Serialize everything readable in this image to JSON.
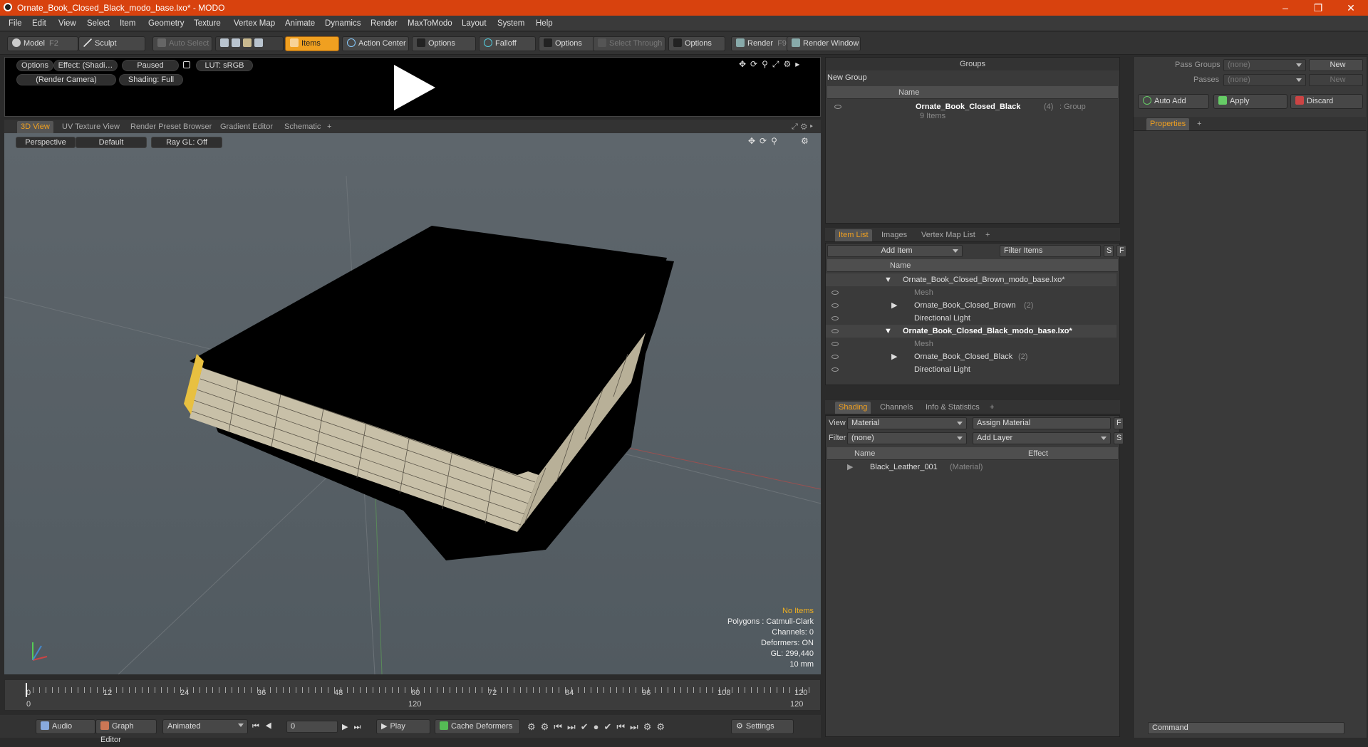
{
  "window": {
    "title": "Ornate_Book_Closed_Black_modo_base.lxo* - MODO"
  },
  "menu": [
    "File",
    "Edit",
    "View",
    "Select",
    "Item",
    "Geometry",
    "Texture",
    "Vertex Map",
    "Animate",
    "Dynamics",
    "Render",
    "MaxToModo",
    "Layout",
    "System",
    "Help"
  ],
  "toolbar": {
    "model": "Model",
    "model_key": "F2",
    "sculpt": "Sculpt",
    "auto_select": "Auto Select",
    "items": "Items",
    "action_center": "Action Center",
    "options1": "Options",
    "falloff": "Falloff",
    "options2": "Options",
    "select_through": "Select Through",
    "options3": "Options",
    "render": "Render",
    "render_key": "F9",
    "render_window": "Render Window"
  },
  "anim_preview": {
    "options": "Options",
    "effect": "Effect: (Shadi…",
    "paused": "Paused",
    "lut": "LUT: sRGB",
    "camera": "(Render Camera)",
    "shading": "Shading: Full"
  },
  "view_tabs": [
    "3D View",
    "UV Texture View",
    "Render Preset Browser",
    "Gradient Editor",
    "Schematic"
  ],
  "viewport": {
    "perspective": "Perspective",
    "default": "Default",
    "raygl": "Ray GL: Off",
    "info": {
      "no_items": "No Items",
      "polygons": "Polygons : Catmull-Clark",
      "channels": "Channels: 0",
      "deformers": "Deformers: ON",
      "gl": "GL: 299,440",
      "scale": "10 mm"
    }
  },
  "timeline": {
    "ticks": [
      "0",
      "12",
      "24",
      "36",
      "48",
      "60",
      "72",
      "84",
      "96",
      "108",
      "120"
    ],
    "start": "0",
    "mid": "120",
    "end": "120"
  },
  "bottombar": {
    "audio": "Audio",
    "graph_editor": "Graph Editor",
    "animated": "Animated",
    "frame": "0",
    "play": "Play",
    "cache_deformers": "Cache Deformers",
    "settings": "Settings"
  },
  "groups": {
    "title": "Groups",
    "new_group": "New Group",
    "col_name": "Name",
    "item_name": "Ornate_Book_Closed_Black",
    "item_count": "(4)",
    "item_type": ": Group",
    "item_sub": "9 Items"
  },
  "itemlist": {
    "tabs": [
      "Item List",
      "Images",
      "Vertex Map List"
    ],
    "add_item": "Add Item",
    "filter": "Filter Items",
    "s": "S",
    "f": "F",
    "col_name": "Name",
    "rows": [
      {
        "label": "Ornate_Book_Closed_Brown_modo_base.lxo*",
        "count": ""
      },
      {
        "label": "Mesh",
        "count": ""
      },
      {
        "label": "Ornate_Book_Closed_Brown",
        "count": "(2)"
      },
      {
        "label": "Directional Light",
        "count": ""
      },
      {
        "label": "Ornate_Book_Closed_Black_modo_base.lxo*",
        "count": ""
      },
      {
        "label": "Mesh",
        "count": ""
      },
      {
        "label": "Ornate_Book_Closed_Black",
        "count": "(2)"
      },
      {
        "label": "Directional Light",
        "count": ""
      }
    ]
  },
  "shading": {
    "tabs": [
      "Shading",
      "Channels",
      "Info & Statistics"
    ],
    "view_label": "View",
    "view_value": "Material",
    "assign": "Assign Material",
    "f": "F",
    "filter_label": "Filter",
    "filter_value": "(none)",
    "add_layer": "Add Layer",
    "s": "S",
    "col_name": "Name",
    "col_effect": "Effect",
    "material": "Black_Leather_001",
    "material_type": "(Material)"
  },
  "passes": {
    "pass_groups": "Pass Groups",
    "pass_groups_val": "(none)",
    "new1": "New",
    "passes": "Passes",
    "passes_val": "(none)",
    "new2": "New",
    "auto_add": "Auto Add",
    "apply": "Apply",
    "discard": "Discard",
    "properties": "Properties",
    "command": "Command"
  }
}
